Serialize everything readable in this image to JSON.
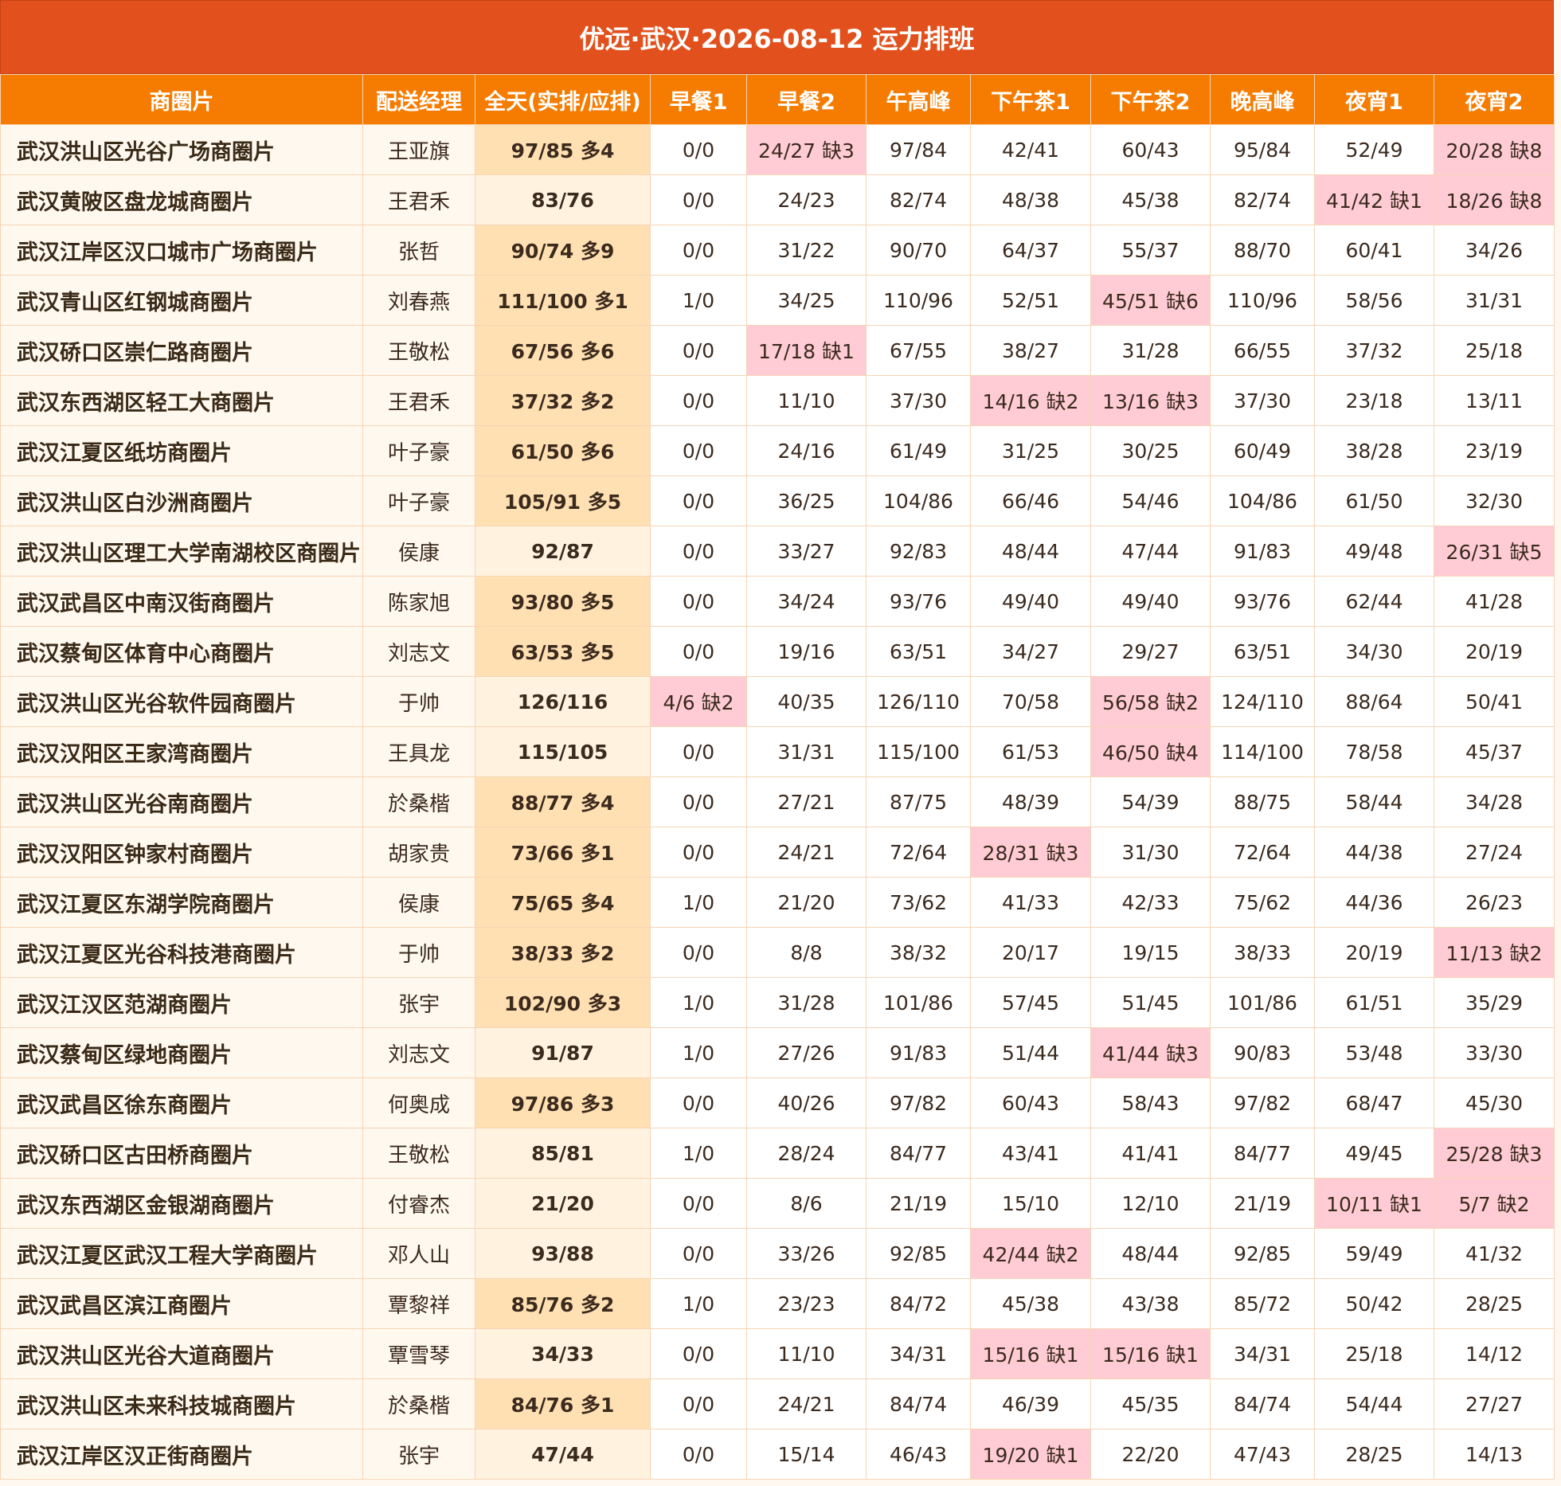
{
  "title": "优远·武汉·2026-08-12 运力排班",
  "headers": [
    "商圈片",
    "配送经理",
    "全天(实排/应排)",
    "早餐1",
    "早餐2",
    "午高峰",
    "下午茶1",
    "下午茶2",
    "晚高峰",
    "夜宵1",
    "夜宵2"
  ],
  "colors": {
    "title_bg": "#e2511d",
    "header_bg": "#f57c00",
    "shortage_bg": "#ffccd5",
    "surplus_bg": "#ffe0b2",
    "total_bg": "#fff3e0",
    "area_bg": "#fff8ee"
  },
  "rows": [
    {
      "area": "武汉洪山区光谷广场商圈片",
      "manager": "王亚旗",
      "total": "97/85 多4",
      "slots": [
        "0/0",
        "24/27 缺3",
        "97/84",
        "42/41",
        "60/43",
        "95/84",
        "52/49",
        "20/28 缺8"
      ]
    },
    {
      "area": "武汉黄陂区盘龙城商圈片",
      "manager": "王君禾",
      "total": "83/76",
      "slots": [
        "0/0",
        "24/23",
        "82/74",
        "48/38",
        "45/38",
        "82/74",
        "41/42 缺1",
        "18/26 缺8"
      ]
    },
    {
      "area": "武汉江岸区汉口城市广场商圈片",
      "manager": "张哲",
      "total": "90/74 多9",
      "slots": [
        "0/0",
        "31/22",
        "90/70",
        "64/37",
        "55/37",
        "88/70",
        "60/41",
        "34/26"
      ]
    },
    {
      "area": "武汉青山区红钢城商圈片",
      "manager": "刘春燕",
      "total": "111/100 多1",
      "slots": [
        "1/0",
        "34/25",
        "110/96",
        "52/51",
        "45/51 缺6",
        "110/96",
        "58/56",
        "31/31"
      ]
    },
    {
      "area": "武汉硚口区崇仁路商圈片",
      "manager": "王敬松",
      "total": "67/56 多6",
      "slots": [
        "0/0",
        "17/18 缺1",
        "67/55",
        "38/27",
        "31/28",
        "66/55",
        "37/32",
        "25/18"
      ]
    },
    {
      "area": "武汉东西湖区轻工大商圈片",
      "manager": "王君禾",
      "total": "37/32 多2",
      "slots": [
        "0/0",
        "11/10",
        "37/30",
        "14/16 缺2",
        "13/16 缺3",
        "37/30",
        "23/18",
        "13/11"
      ]
    },
    {
      "area": "武汉江夏区纸坊商圈片",
      "manager": "叶子豪",
      "total": "61/50 多6",
      "slots": [
        "0/0",
        "24/16",
        "61/49",
        "31/25",
        "30/25",
        "60/49",
        "38/28",
        "23/19"
      ]
    },
    {
      "area": "武汉洪山区白沙洲商圈片",
      "manager": "叶子豪",
      "total": "105/91 多5",
      "slots": [
        "0/0",
        "36/25",
        "104/86",
        "66/46",
        "54/46",
        "104/86",
        "61/50",
        "32/30"
      ]
    },
    {
      "area": "武汉洪山区理工大学南湖校区商圈片",
      "manager": "侯康",
      "total": "92/87",
      "slots": [
        "0/0",
        "33/27",
        "92/83",
        "48/44",
        "47/44",
        "91/83",
        "49/48",
        "26/31 缺5"
      ]
    },
    {
      "area": "武汉武昌区中南汉街商圈片",
      "manager": "陈家旭",
      "total": "93/80 多5",
      "slots": [
        "0/0",
        "34/24",
        "93/76",
        "49/40",
        "49/40",
        "93/76",
        "62/44",
        "41/28"
      ]
    },
    {
      "area": "武汉蔡甸区体育中心商圈片",
      "manager": "刘志文",
      "total": "63/53 多5",
      "slots": [
        "0/0",
        "19/16",
        "63/51",
        "34/27",
        "29/27",
        "63/51",
        "34/30",
        "20/19"
      ]
    },
    {
      "area": "武汉洪山区光谷软件园商圈片",
      "manager": "于帅",
      "total": "126/116",
      "slots": [
        "4/6 缺2",
        "40/35",
        "126/110",
        "70/58",
        "56/58 缺2",
        "124/110",
        "88/64",
        "50/41"
      ]
    },
    {
      "area": "武汉汉阳区王家湾商圈片",
      "manager": "王具龙",
      "total": "115/105",
      "slots": [
        "0/0",
        "31/31",
        "115/100",
        "61/53",
        "46/50 缺4",
        "114/100",
        "78/58",
        "45/37"
      ]
    },
    {
      "area": "武汉洪山区光谷南商圈片",
      "manager": "於桑楷",
      "total": "88/77 多4",
      "slots": [
        "0/0",
        "27/21",
        "87/75",
        "48/39",
        "54/39",
        "88/75",
        "58/44",
        "34/28"
      ]
    },
    {
      "area": "武汉汉阳区钟家村商圈片",
      "manager": "胡家贵",
      "total": "73/66 多1",
      "slots": [
        "0/0",
        "24/21",
        "72/64",
        "28/31 缺3",
        "31/30",
        "72/64",
        "44/38",
        "27/24"
      ]
    },
    {
      "area": "武汉江夏区东湖学院商圈片",
      "manager": "侯康",
      "total": "75/65 多4",
      "slots": [
        "1/0",
        "21/20",
        "73/62",
        "41/33",
        "42/33",
        "75/62",
        "44/36",
        "26/23"
      ]
    },
    {
      "area": "武汉江夏区光谷科技港商圈片",
      "manager": "于帅",
      "total": "38/33 多2",
      "slots": [
        "0/0",
        "8/8",
        "38/32",
        "20/17",
        "19/15",
        "38/33",
        "20/19",
        "11/13 缺2"
      ]
    },
    {
      "area": "武汉江汉区范湖商圈片",
      "manager": "张宇",
      "total": "102/90 多3",
      "slots": [
        "1/0",
        "31/28",
        "101/86",
        "57/45",
        "51/45",
        "101/86",
        "61/51",
        "35/29"
      ]
    },
    {
      "area": "武汉蔡甸区绿地商圈片",
      "manager": "刘志文",
      "total": "91/87",
      "slots": [
        "1/0",
        "27/26",
        "91/83",
        "51/44",
        "41/44 缺3",
        "90/83",
        "53/48",
        "33/30"
      ]
    },
    {
      "area": "武汉武昌区徐东商圈片",
      "manager": "何奥成",
      "total": "97/86 多3",
      "slots": [
        "0/0",
        "40/26",
        "97/82",
        "60/43",
        "58/43",
        "97/82",
        "68/47",
        "45/30"
      ]
    },
    {
      "area": "武汉硚口区古田桥商圈片",
      "manager": "王敬松",
      "total": "85/81",
      "slots": [
        "1/0",
        "28/24",
        "84/77",
        "43/41",
        "41/41",
        "84/77",
        "49/45",
        "25/28 缺3"
      ]
    },
    {
      "area": "武汉东西湖区金银湖商圈片",
      "manager": "付睿杰",
      "total": "21/20",
      "slots": [
        "0/0",
        "8/6",
        "21/19",
        "15/10",
        "12/10",
        "21/19",
        "10/11 缺1",
        "5/7 缺2"
      ]
    },
    {
      "area": "武汉江夏区武汉工程大学商圈片",
      "manager": "邓人山",
      "total": "93/88",
      "slots": [
        "0/0",
        "33/26",
        "92/85",
        "42/44 缺2",
        "48/44",
        "92/85",
        "59/49",
        "41/32"
      ]
    },
    {
      "area": "武汉武昌区滨江商圈片",
      "manager": "覃黎祥",
      "total": "85/76 多2",
      "slots": [
        "1/0",
        "23/23",
        "84/72",
        "45/38",
        "43/38",
        "85/72",
        "50/42",
        "28/25"
      ]
    },
    {
      "area": "武汉洪山区光谷大道商圈片",
      "manager": "覃雪琴",
      "total": "34/33",
      "slots": [
        "0/0",
        "11/10",
        "34/31",
        "15/16 缺1",
        "15/16 缺1",
        "34/31",
        "25/18",
        "14/12"
      ]
    },
    {
      "area": "武汉洪山区未来科技城商圈片",
      "manager": "於桑楷",
      "total": "84/76 多1",
      "slots": [
        "0/0",
        "24/21",
        "84/74",
        "46/39",
        "45/35",
        "84/74",
        "54/44",
        "27/27"
      ]
    },
    {
      "area": "武汉江岸区汉正街商圈片",
      "manager": "张宇",
      "total": "47/44",
      "slots": [
        "0/0",
        "15/14",
        "46/43",
        "19/20 缺1",
        "22/20",
        "47/43",
        "28/25",
        "14/13"
      ]
    }
  ]
}
